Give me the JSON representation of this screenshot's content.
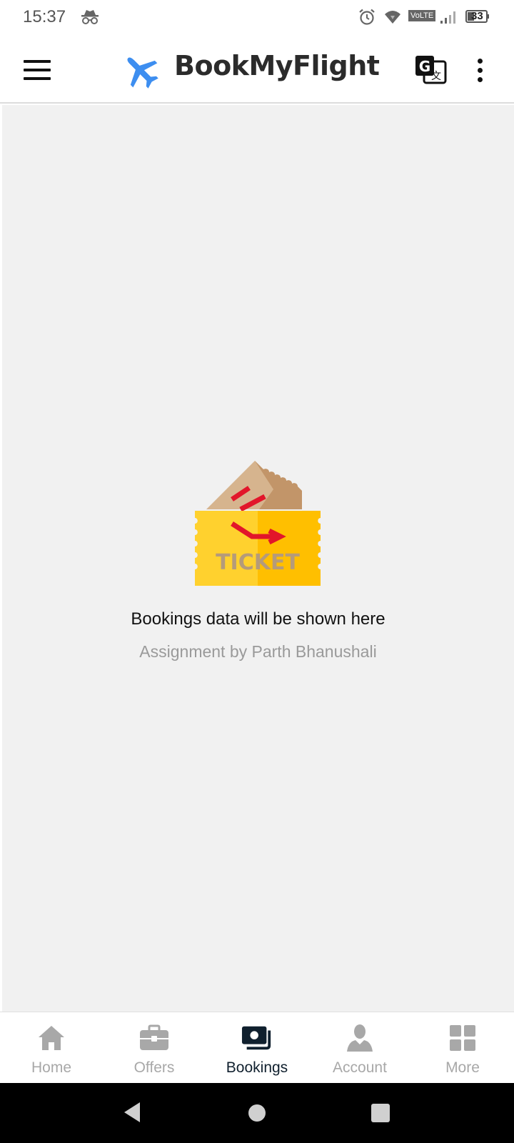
{
  "status_bar": {
    "time": "15:37",
    "left_icons": [
      "incognito-icon"
    ],
    "right_icons": [
      "alarm-icon",
      "wifi-icon",
      "volte-badge",
      "signal-icon",
      "battery-icon"
    ],
    "volte_label": "VoLTE",
    "battery_level": "33"
  },
  "app_bar": {
    "title": "BookMyFlight",
    "logo_icon": "airplane-icon",
    "actions": [
      "google-translate-icon",
      "more-vert-icon"
    ],
    "menu_icon": "hamburger-menu-icon"
  },
  "empty_state": {
    "illustration": "ticket-illustration",
    "illustration_text": "TICKET",
    "title": "Bookings data will be shown here",
    "subtitle": "Assignment by Parth Bhanushali"
  },
  "bottom_nav": {
    "items": [
      {
        "label": "Home",
        "icon": "home-icon",
        "active": false
      },
      {
        "label": "Offers",
        "icon": "briefcase-icon",
        "active": false
      },
      {
        "label": "Bookings",
        "icon": "bookings-icon",
        "active": true
      },
      {
        "label": "Account",
        "icon": "account-icon",
        "active": false
      },
      {
        "label": "More",
        "icon": "grid-icon",
        "active": false
      }
    ]
  },
  "colors": {
    "accent_blue": "#3d8ef0",
    "active_nav": "#10202e",
    "inactive_nav": "#a8a8a8",
    "content_bg": "#f1f1f1",
    "ticket_yellow": "#ffd12e",
    "ticket_red": "#e2162a"
  }
}
